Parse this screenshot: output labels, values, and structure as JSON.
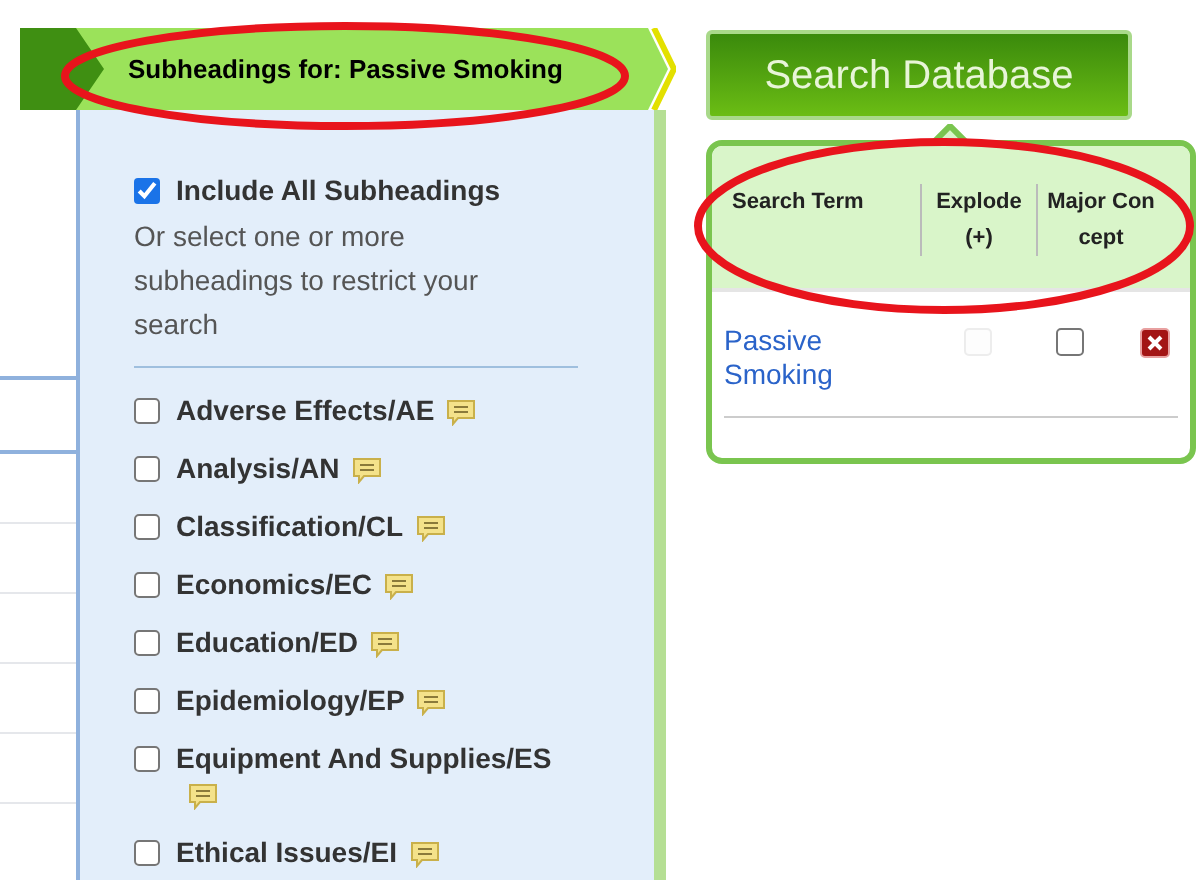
{
  "breadcrumb": {
    "title": "Subheadings for: Passive Smoking"
  },
  "subheadings": {
    "include_all": {
      "label": "Include All Subheadings",
      "checked": true
    },
    "instructions": "Or select one or more subheadings to restrict your search",
    "items": [
      {
        "label": "Adverse Effects/AE",
        "checked": false
      },
      {
        "label": "Analysis/AN",
        "checked": false
      },
      {
        "label": "Classification/CL",
        "checked": false
      },
      {
        "label": "Economics/EC",
        "checked": false
      },
      {
        "label": "Education/ED",
        "checked": false
      },
      {
        "label": "Epidemiology/EP",
        "checked": false
      },
      {
        "label": "Equipment And Supplies/ES",
        "checked": false
      },
      {
        "label": "Ethical Issues/EI",
        "checked": false
      }
    ]
  },
  "search_button": "Search Database",
  "search_builder": {
    "columns": [
      "Search Term",
      "Explode (+)",
      "Major Concept"
    ],
    "rows": [
      {
        "term": "Passive Smoking",
        "explode": {
          "checked": false,
          "disabled": true
        },
        "major_concept": {
          "checked": false,
          "disabled": false
        }
      }
    ]
  }
}
